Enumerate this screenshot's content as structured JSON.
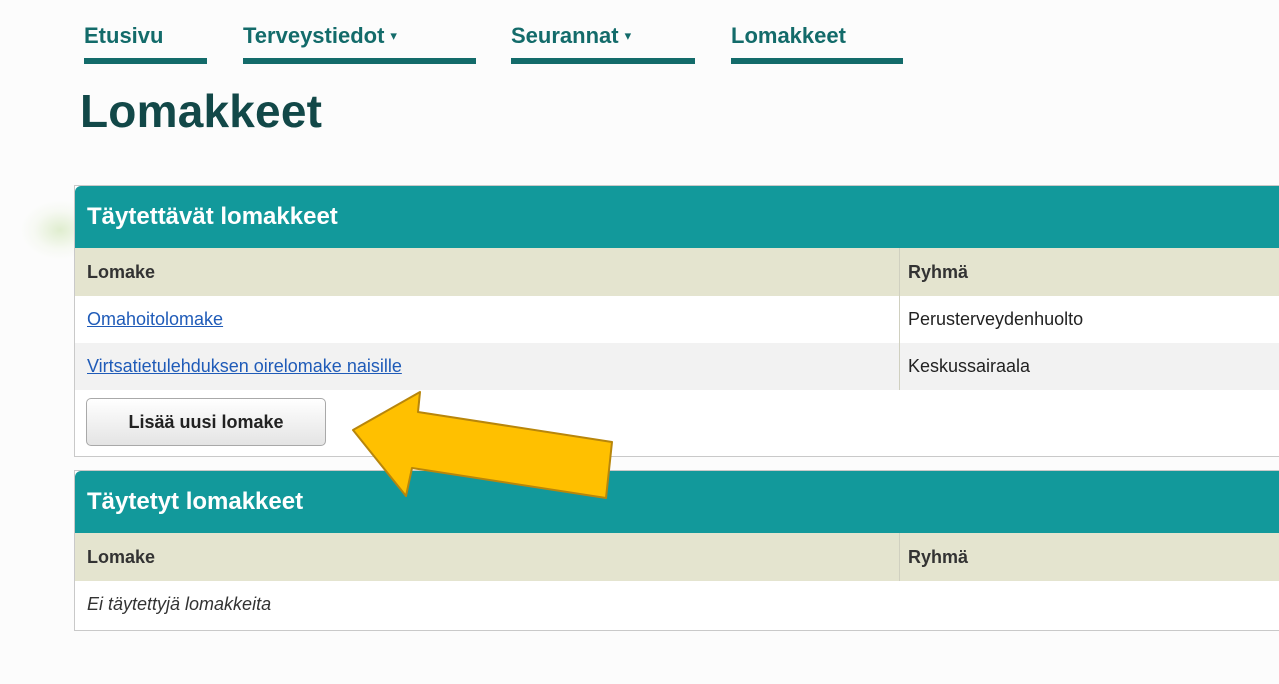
{
  "nav": {
    "items": [
      {
        "label": "Etusivu",
        "has_dropdown": false
      },
      {
        "label": "Terveystiedot",
        "has_dropdown": true
      },
      {
        "label": "Seurannat",
        "has_dropdown": true
      },
      {
        "label": "Lomakkeet",
        "has_dropdown": false
      }
    ],
    "caret": "▾"
  },
  "page": {
    "title": "Lomakkeet"
  },
  "fillable": {
    "title": "Täytettävät lomakkeet",
    "columns": [
      "Lomake",
      "Ryhmä"
    ],
    "rows": [
      {
        "form": "Omahoitolomake",
        "group": "Perusterveydenhuolto"
      },
      {
        "form": "Virtsatietulehduksen oirelomake naisille",
        "group": "Keskussairaala"
      }
    ],
    "add_button": "Lisää uusi lomake"
  },
  "filled": {
    "title": "Täytetyt lomakkeet",
    "columns": [
      "Lomake",
      "Ryhmä"
    ],
    "empty_text": "Ei täytettyjä lomakkeita"
  },
  "colors": {
    "accent": "#12999b",
    "nav_text": "#136b6a",
    "title": "#124848",
    "table_header_bg": "#e4e4cf",
    "link": "#1f5bb8",
    "annotation_arrow": "#ffc000"
  },
  "annotation": {
    "icon": "pointer-arrow-icon"
  }
}
